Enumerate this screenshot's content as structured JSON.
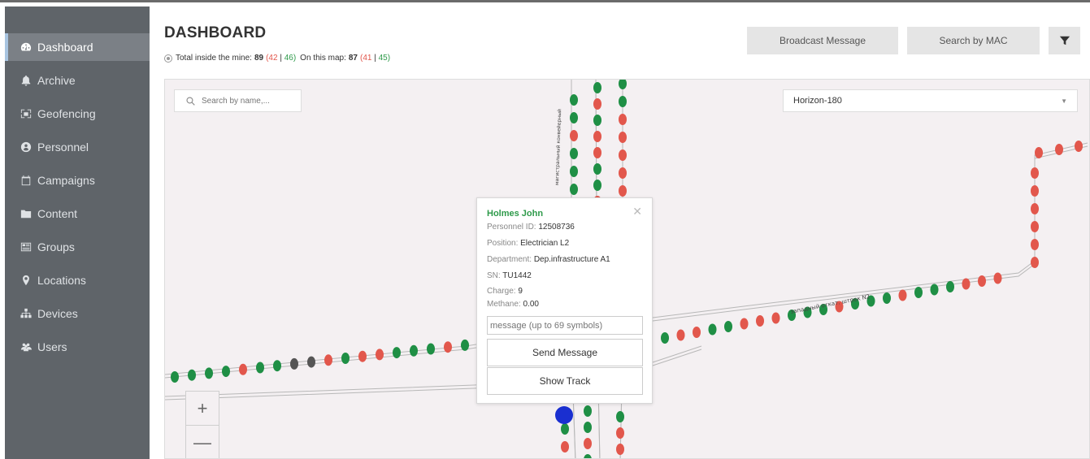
{
  "sidebar": {
    "items": [
      {
        "label": "Dashboard",
        "icon": "dashboard-icon",
        "active": true
      },
      {
        "label": "Archive",
        "icon": "bell-icon"
      },
      {
        "label": "Geofencing",
        "icon": "geofence-icon"
      },
      {
        "label": "Personnel",
        "icon": "personnel-icon"
      },
      {
        "label": "Campaigns",
        "icon": "calendar-icon"
      },
      {
        "label": "Content",
        "icon": "folder-icon"
      },
      {
        "label": "Groups",
        "icon": "groups-icon"
      },
      {
        "label": "Locations",
        "icon": "map-marker-icon"
      },
      {
        "label": "Devices",
        "icon": "sitemap-icon"
      },
      {
        "label": "Users",
        "icon": "users-icon"
      }
    ]
  },
  "header": {
    "title": "DASHBOARD",
    "stats": {
      "total_label": "Total inside the mine:",
      "total": "89",
      "total_red": "42",
      "total_green": "46",
      "map_label": "On this map:",
      "map_total": "87",
      "map_red": "41",
      "map_green": "45"
    },
    "broadcast_label": "Broadcast Message",
    "search_mac_label": "Search by MAC",
    "filter_icon": "filter-icon"
  },
  "map": {
    "search_placeholder": "Search by name,...",
    "level_selected": "Horizon-180",
    "zoom_in": "+",
    "zoom_out": "—",
    "tunnel_labels": [
      "западный  откат. штрек N2",
      "магистральный конвейерный"
    ],
    "colors": {
      "red": "#e2574c",
      "green": "#1f8f45",
      "grey": "#555555",
      "blue": "#1a2fd0",
      "bg": "#f4f0f2"
    }
  },
  "popup": {
    "name": "Holmes John",
    "personnel_id_label": "Personnel ID:",
    "personnel_id": "12508736",
    "position_label": "Position:",
    "position": "Electrician L2",
    "department_label": "Department:",
    "department": "Dep.infrastructure A1",
    "sn_label": "SN:",
    "sn": "TU1442",
    "charge_label": "Charge:",
    "charge": "9",
    "methane_label": "Methane:",
    "methane": "0.00",
    "message_placeholder": "message (up to 69 symbols)",
    "send_label": "Send Message",
    "track_label": "Show Track"
  }
}
